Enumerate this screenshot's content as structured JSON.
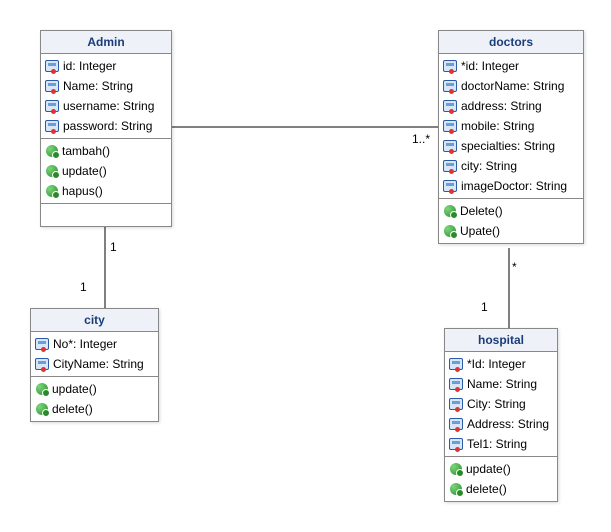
{
  "classes": {
    "admin": {
      "title": "Admin",
      "attrs": [
        "id: Integer",
        "Name: String",
        "username: String",
        "password: String"
      ],
      "methods": [
        "tambah()",
        "update()",
        "hapus()"
      ]
    },
    "doctors": {
      "title": "doctors",
      "attrs": [
        "*id: Integer",
        "doctorName: String",
        "address: String",
        "mobile: String",
        "specialties: String",
        "city: String",
        "imageDoctor: String"
      ],
      "methods": [
        "Delete()",
        "Upate()"
      ]
    },
    "city": {
      "title": "city",
      "attrs": [
        "No*: Integer",
        "CityName: String"
      ],
      "methods": [
        "update()",
        "delete()"
      ]
    },
    "hospital": {
      "title": "hospital",
      "attrs": [
        "*Id: Integer",
        "Name: String",
        "City: String",
        "Address: String",
        "Tel1: String"
      ],
      "methods": [
        "update()",
        "delete()"
      ]
    }
  },
  "multiplicities": {
    "admin_doctors_left": "",
    "admin_doctors_right": "1..*",
    "admin_city_top": "1",
    "admin_city_bottom": "1",
    "doctors_hospital_top": "*",
    "doctors_hospital_bottom": "1"
  }
}
